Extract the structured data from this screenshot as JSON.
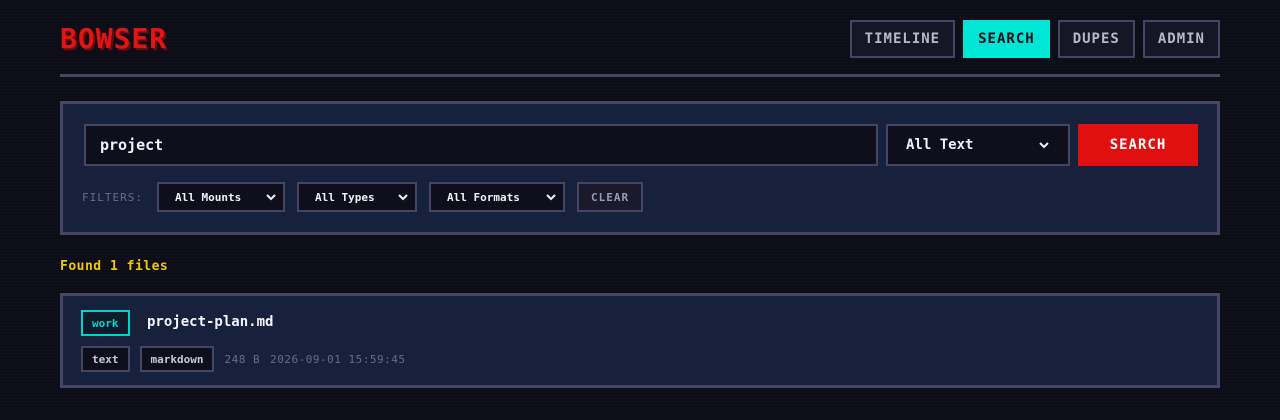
{
  "app": {
    "logo": "BOWSER"
  },
  "nav": {
    "items": [
      {
        "label": "TIMELINE"
      },
      {
        "label": "SEARCH"
      },
      {
        "label": "DUPES"
      },
      {
        "label": "ADMIN"
      }
    ],
    "active": "SEARCH"
  },
  "search": {
    "query": "project",
    "mode": "All Text",
    "submit_label": "SEARCH"
  },
  "filters": {
    "label": "FILTERS:",
    "mounts": "All Mounts",
    "types": "All Types",
    "formats": "All Formats",
    "clear_label": "CLEAR"
  },
  "results": {
    "summary": "Found 1 files",
    "items": [
      {
        "mount": "work",
        "filename": "project-plan.md",
        "type": "text",
        "format": "markdown",
        "size": "248 B",
        "modified": "2026-09-01 15:59:45"
      }
    ]
  },
  "colors": {
    "background": "#0d0d17",
    "panel": "#17213c",
    "border": "#454566",
    "logo": "#e01616",
    "accent": "#00e6d6",
    "submit": "#e01010",
    "summary": "#f0c800"
  }
}
